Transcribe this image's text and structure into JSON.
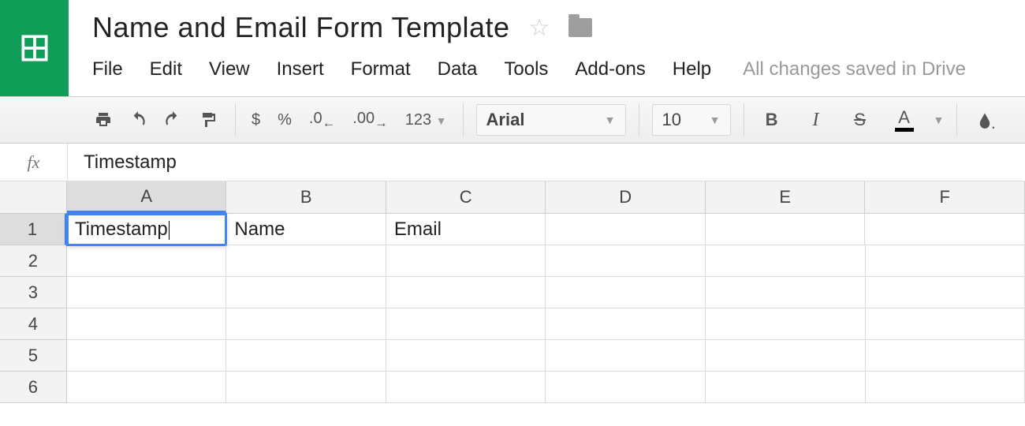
{
  "doc": {
    "title": "Name and Email Form Template",
    "save_status": "All changes saved in Drive"
  },
  "menu": {
    "file": "File",
    "edit": "Edit",
    "view": "View",
    "insert": "Insert",
    "format": "Format",
    "data": "Data",
    "tools": "Tools",
    "addons": "Add-ons",
    "help": "Help"
  },
  "toolbar": {
    "currency": "$",
    "percent": "%",
    "dec_decrease": ".0",
    "dec_increase": ".00",
    "more_formats": "123",
    "font_name": "Arial",
    "font_size": "10",
    "bold": "B",
    "italic": "I",
    "strike": "S",
    "text_color": "A"
  },
  "formula_bar": {
    "fx": "fx",
    "value": "Timestamp"
  },
  "sheet": {
    "columns": [
      "A",
      "B",
      "C",
      "D",
      "E",
      "F"
    ],
    "rows": [
      "1",
      "2",
      "3",
      "4",
      "5",
      "6"
    ],
    "selected_col": "A",
    "selected_row": "1",
    "cells": {
      "A1": "Timestamp",
      "B1": "Name",
      "C1": "Email"
    }
  }
}
